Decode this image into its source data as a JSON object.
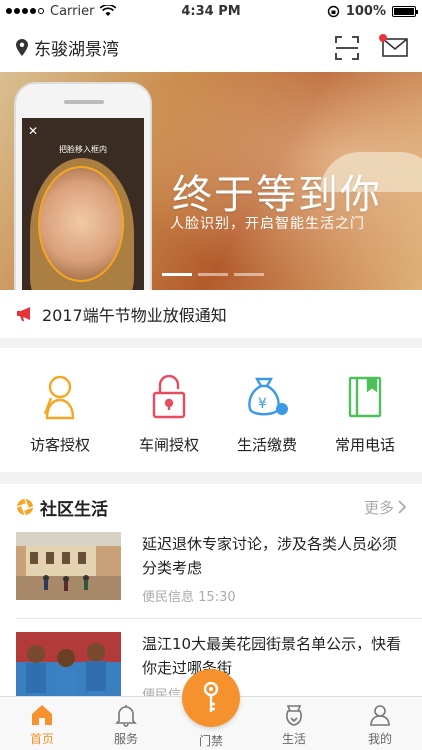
{
  "status": {
    "carrier": "Carrier",
    "time": "4:34 PM",
    "battery": "100%"
  },
  "header": {
    "location": "东骏湖景湾"
  },
  "banner": {
    "slogan": "终于等到你",
    "subtitle": "人脸识别，开启智能生活之门",
    "phone_hint": "把脸移入框内",
    "slides": 3,
    "active_slide": 0
  },
  "notice": {
    "text": "2017端午节物业放假通知"
  },
  "services": [
    {
      "label": "访客授权",
      "icon": "visitor-icon"
    },
    {
      "label": "车闸授权",
      "icon": "lock-icon"
    },
    {
      "label": "生活缴费",
      "icon": "money-bag-icon"
    },
    {
      "label": "常用电话",
      "icon": "phonebook-icon"
    }
  ],
  "community": {
    "title": "社区生活",
    "more": "更多",
    "articles": [
      {
        "title": "延迟退休专家讨论，涉及各类人员必须分类考虑",
        "category": "便民信息",
        "time": "15:30"
      },
      {
        "title": "温江10大最美花园街景名单公示，快看你走过哪条街",
        "category": "便民信息",
        "time": ""
      }
    ]
  },
  "tabs": [
    {
      "label": "首页",
      "icon": "home-icon",
      "active": true
    },
    {
      "label": "服务",
      "icon": "bell-icon",
      "active": false
    },
    {
      "label": "门禁",
      "icon": "key-icon",
      "active": false
    },
    {
      "label": "生活",
      "icon": "shopping-bag-icon",
      "active": false
    },
    {
      "label": "我的",
      "icon": "person-icon",
      "active": false
    }
  ],
  "colors": {
    "accent": "#f5922e",
    "notice_red": "#e8323c",
    "service_orange": "#f5a623",
    "service_red": "#e84a5f",
    "service_blue": "#3b9ae8",
    "service_green": "#4cc15a"
  }
}
